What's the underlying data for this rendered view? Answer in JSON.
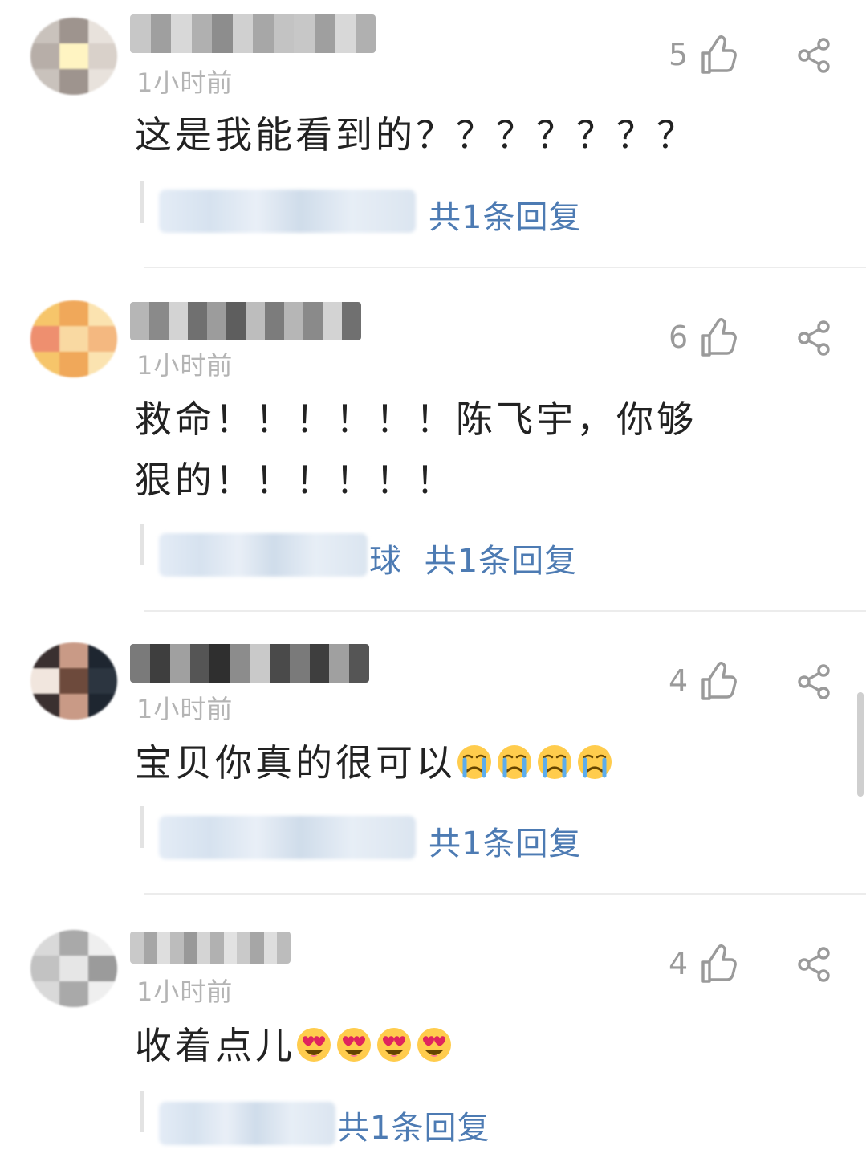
{
  "comments": [
    {
      "time": "1小时前",
      "likes": "5",
      "text": "这是我能看到的？？？？？？？",
      "reply_link": "共1条回复",
      "avatar_colors": [
        "#c9c2bc",
        "#9e948e",
        "#e8e2dc",
        "#b7aea8",
        "#fff4c2",
        "#d9d1ca"
      ],
      "name_colors": [
        "#c7c7c7",
        "#9f9f9f",
        "#d8d8d8",
        "#b0b0b0",
        "#8d8d8d",
        "#d0d0d0",
        "#a7a7a7",
        "#c3c3c3"
      ],
      "reply_blur_width": 320
    },
    {
      "time": "1小时前",
      "likes": "6",
      "text": "救命！！！！！！陈飞宇，你够狠的！！！！！！",
      "reply_prefix": "球",
      "reply_link": "共1条回复",
      "avatar_colors": [
        "#f6c56a",
        "#f0a85a",
        "#fbe3b0",
        "#ee8f6f",
        "#f9d9a2",
        "#f4b880"
      ],
      "name_colors": [
        "#b6b6b6",
        "#8a8a8a",
        "#d3d3d3",
        "#707070",
        "#9c9c9c",
        "#5e5e5e",
        "#bdbdbd",
        "#7c7c7c"
      ],
      "reply_blur_width": 260
    },
    {
      "time": "1小时前",
      "likes": "4",
      "text": "宝贝你真的很可以",
      "emoji": "crying",
      "emoji_count": 4,
      "reply_link": "共1条回复",
      "avatar_colors": [
        "#3a3030",
        "#c99a86",
        "#1e2630",
        "#f1e6de",
        "#6d4a3c",
        "#2c3540"
      ],
      "name_colors": [
        "#7a7a7a",
        "#3e3e3e",
        "#a0a0a0",
        "#555555",
        "#2f2f2f",
        "#8c8c8c",
        "#c9c9c9",
        "#4a4a4a"
      ],
      "reply_blur_width": 320
    },
    {
      "time": "1小时前",
      "likes": "4",
      "text": "收着点儿",
      "emoji": "heart-eyes",
      "emoji_count": 4,
      "reply_link": "共1条回复",
      "avatar_colors": [
        "#d9d9d9",
        "#a9a9a9",
        "#efefef",
        "#c2c2c2",
        "#e6e6e6",
        "#9b9b9b"
      ],
      "name_colors": [
        "#c9c9c9",
        "#a6a6a6",
        "#dedede",
        "#bcbcbc",
        "#999999",
        "#d4d4d4",
        "#b1b1b1",
        "#e2e2e2"
      ],
      "reply_blur_width": 220
    }
  ],
  "colors": {
    "text": "#222222",
    "time": "#b4b4b4",
    "like": "#9a9a9a",
    "link": "#4d7bb3",
    "divider": "#ececec"
  }
}
